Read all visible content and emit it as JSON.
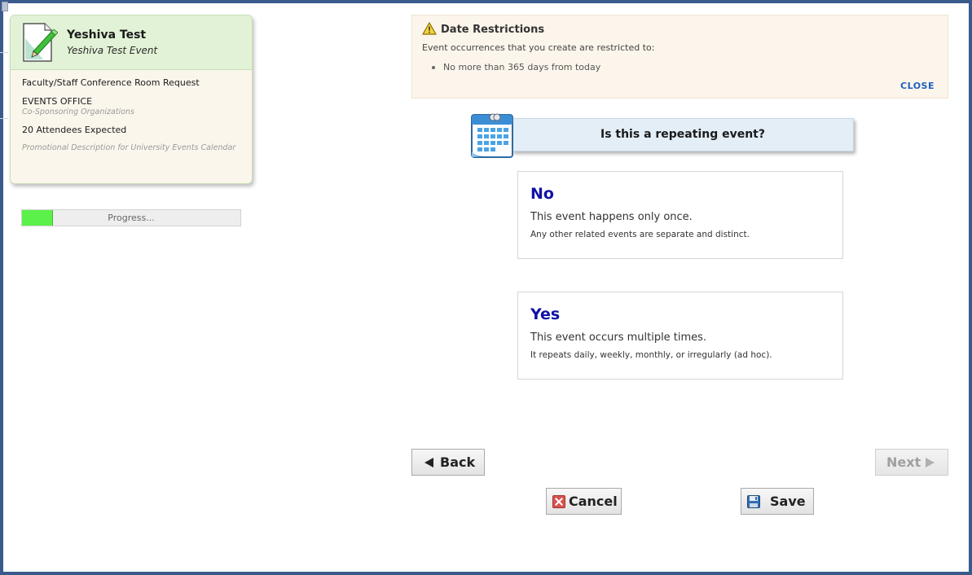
{
  "summary": {
    "title": "Yeshiva Test",
    "subtitle": "Yeshiva Test Event",
    "request_type": "Faculty/Staff Conference Room Request",
    "organization": "EVENTS OFFICE",
    "organization_sub": "Co-Sponsoring Organizations",
    "attendees": "20 Attendees Expected",
    "promo": "Promotional Description for University Events Calendar"
  },
  "progress": {
    "label": "Progress...",
    "fill_fraction": 0.14,
    "fill_color": "#5cf04a"
  },
  "restrictions": {
    "title": "Date Restrictions",
    "description": "Event occurrences that you create are restricted to:",
    "items": [
      "No more than 365 days from today"
    ],
    "close_label": "CLOSE",
    "icon": "warning-icon"
  },
  "question": {
    "text": "Is this a repeating event?",
    "icon": "calendar-icon"
  },
  "options": {
    "no": {
      "title": "No",
      "description": "This event happens only once.",
      "detail": "Any other related events are separate and distinct."
    },
    "yes": {
      "title": "Yes",
      "description": "This event occurs multiple times.",
      "detail": "It repeats daily, weekly, monthly, or irregularly (ad hoc)."
    }
  },
  "buttons": {
    "back": "Back",
    "next": "Next",
    "cancel": "Cancel",
    "save": "Save"
  },
  "colors": {
    "frame": "#3a5a8c",
    "option_title": "#1010a8",
    "close_link": "#1f5fbf"
  }
}
